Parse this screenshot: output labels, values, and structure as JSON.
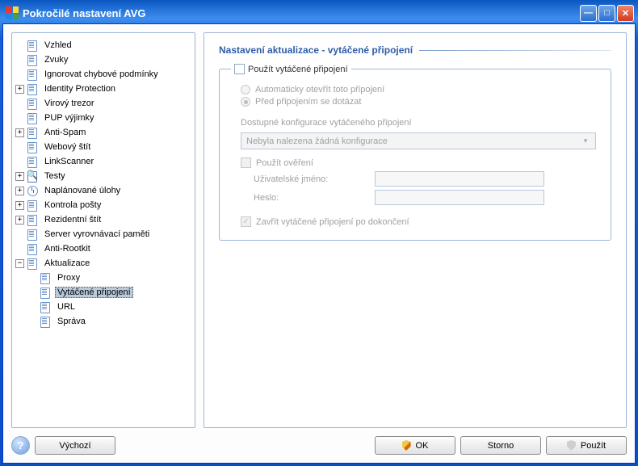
{
  "window": {
    "title": "Pokročilé nastavení AVG"
  },
  "tree": {
    "items": [
      {
        "label": "Vzhled"
      },
      {
        "label": "Zvuky"
      },
      {
        "label": "Ignorovat chybové podmínky"
      },
      {
        "label": "Identity Protection",
        "exp": "+"
      },
      {
        "label": "Virový trezor"
      },
      {
        "label": "PUP výjimky"
      },
      {
        "label": "Anti-Spam",
        "exp": "+"
      },
      {
        "label": "Webový štít"
      },
      {
        "label": "LinkScanner"
      },
      {
        "label": "Testy",
        "exp": "+",
        "icon": "test"
      },
      {
        "label": "Naplánované úlohy",
        "exp": "+",
        "icon": "clock"
      },
      {
        "label": "Kontrola pošty",
        "exp": "+"
      },
      {
        "label": "Rezidentní štít",
        "exp": "+"
      },
      {
        "label": "Server vyrovnávací paměti"
      },
      {
        "label": "Anti-Rootkit"
      },
      {
        "label": "Aktualizace",
        "exp": "-",
        "children": [
          {
            "label": "Proxy"
          },
          {
            "label": "Vytáčené připojení",
            "selected": true
          },
          {
            "label": "URL"
          },
          {
            "label": "Správa"
          }
        ]
      }
    ]
  },
  "content": {
    "title": "Nastavení aktualizace - vytáčené připojení",
    "group_legend": "Použít vytáčené připojení",
    "radio1": "Automaticky otevřít toto připojení",
    "radio2": "Před připojením se dotázat",
    "configs_label": "Dostupné konfigurace vytáčeného připojení",
    "dropdown_value": "Nebyla nalezena žádná konfigurace",
    "use_auth": "Použít ověření",
    "username_label": "Uživatelské jméno:",
    "password_label": "Heslo:",
    "close_after": "Zavřít vytáčené připojení po dokončení",
    "username_value": "",
    "password_value": ""
  },
  "buttons": {
    "default": "Výchozí",
    "ok": "OK",
    "cancel": "Storno",
    "apply": "Použít"
  }
}
